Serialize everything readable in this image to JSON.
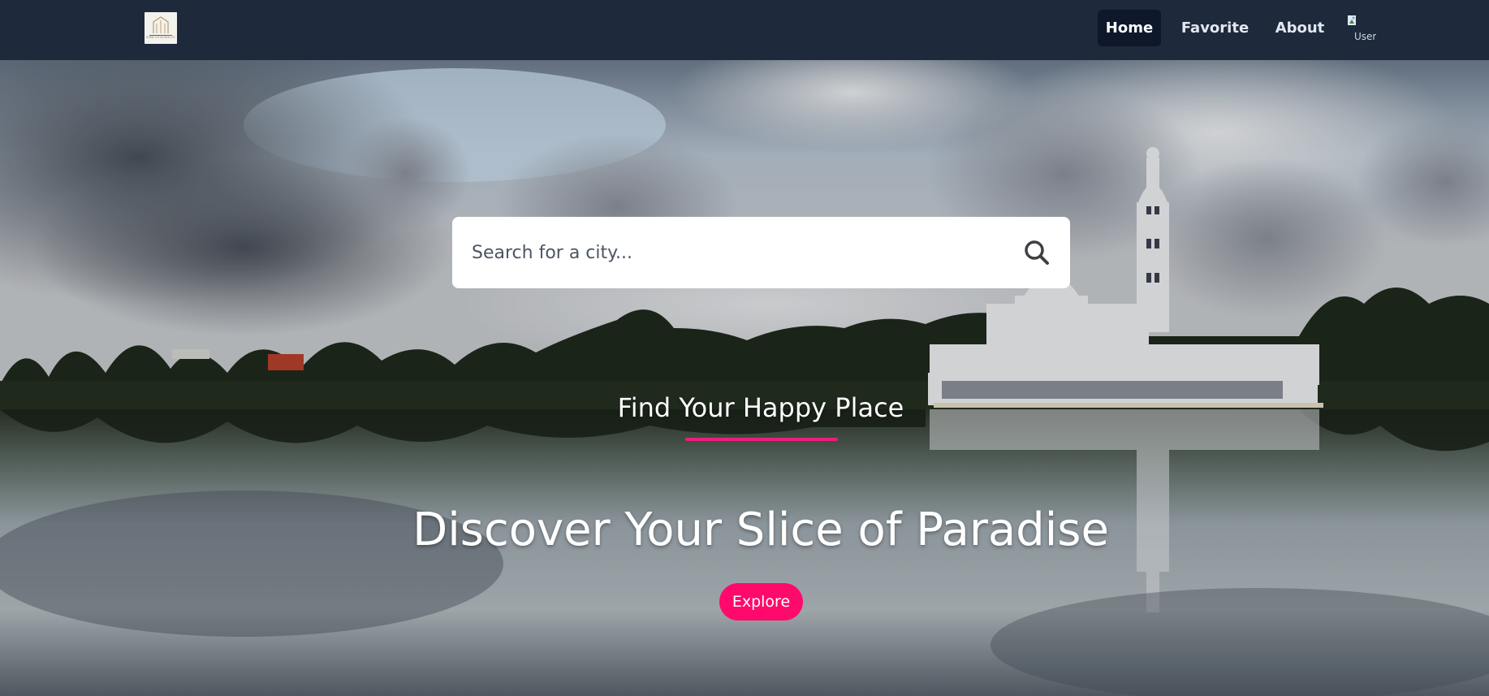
{
  "nav": {
    "logo_text": "HOME LOTUS REAL ESTATE",
    "links": [
      {
        "label": "Home",
        "active": true
      },
      {
        "label": "Favorite",
        "active": false
      },
      {
        "label": "About",
        "active": false
      }
    ],
    "avatar_alt": "User"
  },
  "search": {
    "placeholder": "Search for a city...",
    "icon": "search-icon"
  },
  "hero": {
    "tagline": "Find Your Happy Place",
    "headline": "Discover Your Slice of Paradise",
    "button_label": "Explore"
  },
  "colors": {
    "navbar": "#1e293b",
    "active_link_bg": "#0f172a",
    "accent": "#ff0a6c",
    "underline": "#ec1e79"
  }
}
